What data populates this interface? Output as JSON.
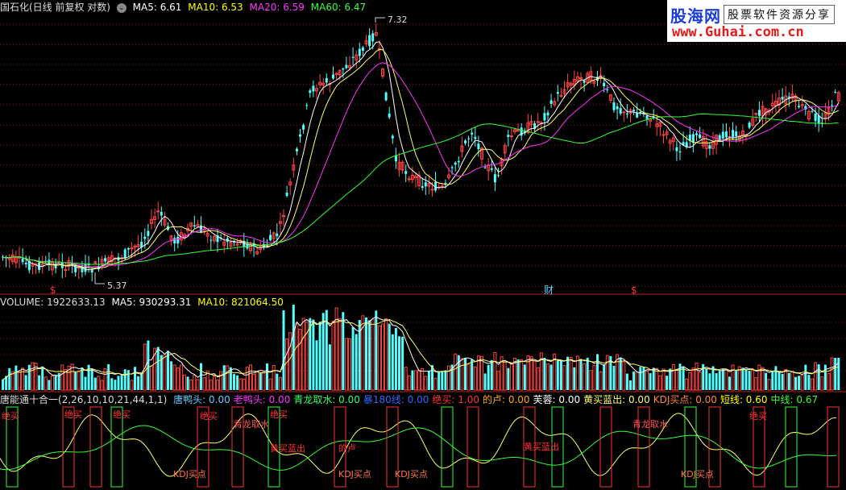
{
  "header": {
    "title": "国石化(日线 前复权 对数)",
    "ma": [
      {
        "label": "MA5: 6.61",
        "color": "#ffffff"
      },
      {
        "label": "MA10: 6.53",
        "color": "#ffff00"
      },
      {
        "label": "MA20: 6.59",
        "color": "#ff33ff"
      },
      {
        "label": "MA60: 6.47",
        "color": "#33ff33"
      }
    ]
  },
  "price_panel": {
    "high_label": "7.32",
    "low_label": "5.37",
    "markers": [
      {
        "text": "$",
        "color": "#ff3333"
      },
      {
        "text": "财",
        "color": "#66ccff"
      },
      {
        "text": "$",
        "color": "#ff3333"
      }
    ]
  },
  "volume_panel": {
    "title": "VOLUME: 1922633.13",
    "ma5": "MA5: 930293.31",
    "ma10": "MA10: 821064.50"
  },
  "indicator_panel": {
    "name": "唐能通十合一",
    "params": "(2,26,10,10,21,44,1,1)",
    "items": [
      {
        "label": "唐鸭头: 0.00",
        "color": "#66ccff"
      },
      {
        "label": "老鸭头: 0.00",
        "color": "#ff33ff"
      },
      {
        "label": "青龙取水: 0.00",
        "color": "#33ff66"
      },
      {
        "label": "暴180线: 0.00",
        "color": "#3366ff"
      },
      {
        "label": "绝买: 1.00",
        "color": "#ff3333"
      },
      {
        "label": "的卢: 0.00",
        "color": "#ffaa00"
      },
      {
        "label": "芙蓉: 0.00",
        "color": "#ffffff"
      },
      {
        "label": "黄买蓝出: 0.00",
        "color": "#ffff66"
      },
      {
        "label": "KDJ买点: 0.00",
        "color": "#ff8844"
      },
      {
        "label": "短线: 0.60",
        "color": "#ffff00"
      },
      {
        "label": "中线: 0.67",
        "color": "#33ff33"
      }
    ],
    "signals": [
      "绝买",
      "绝买",
      "绝买",
      "绝买",
      "绝买",
      "绝买",
      "青龙取水",
      "青龙取水",
      "黄买蓝出",
      "黄买蓝出",
      "的卢",
      "KDJ买点",
      "KDJ买点",
      "KDJ买点",
      "KDJ买点"
    ]
  },
  "logo": {
    "name": "股海网",
    "slogan": "股票软件资源分享",
    "url": "www.Guhai.com.cn"
  },
  "colors": {
    "up": "#ff4444",
    "down": "#54ffff",
    "ma5": "#ffffff",
    "ma10": "#ffff66",
    "ma20": "#ff33ff",
    "ma60": "#33ff33",
    "grid": "#8b1a1a",
    "divider": "#b02020"
  }
}
